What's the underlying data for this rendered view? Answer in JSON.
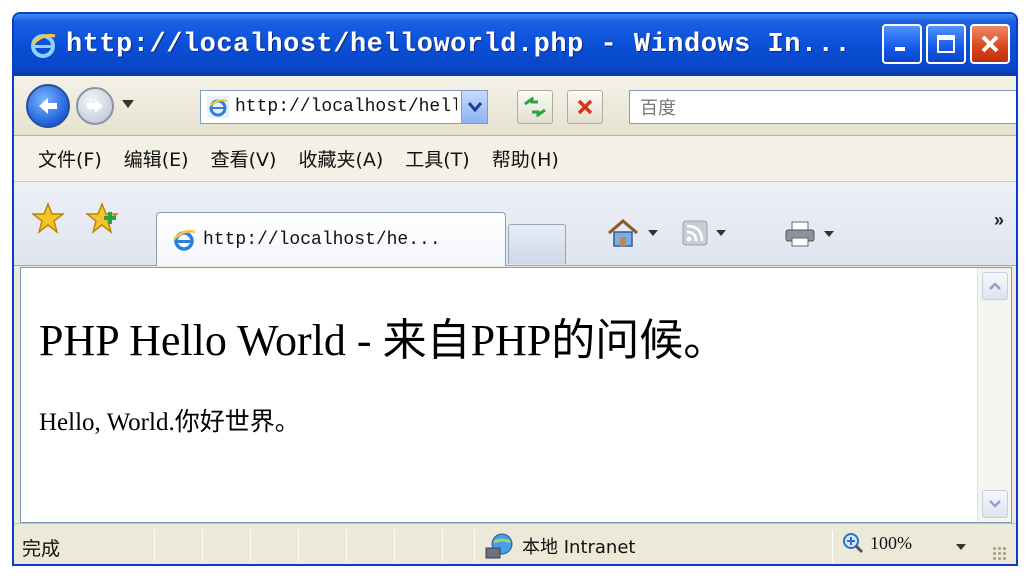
{
  "window": {
    "title": "http://localhost/helloworld.php - Windows In..."
  },
  "address_bar": {
    "url": "http://localhost/helloworld.php",
    "search_placeholder": "百度"
  },
  "menu": {
    "items": [
      "文件(F)",
      "编辑(E)",
      "查看(V)",
      "收藏夹(A)",
      "工具(T)",
      "帮助(H)"
    ]
  },
  "tabs": {
    "active_label": "http://localhost/he...",
    "overflow": "»"
  },
  "page": {
    "heading": "PHP Hello World - 来自PHP的问候。",
    "body": "Hello, World.你好世界。"
  },
  "status": {
    "text": "完成",
    "zone": "本地 Intranet",
    "zoom": "100%"
  },
  "colors": {
    "titlebar": "#0a4fd8",
    "close_button": "#d9431b",
    "chrome": "#ece9d8"
  },
  "icons": [
    "ie-icon",
    "minimize-icon",
    "maximize-icon",
    "close-icon",
    "back-icon",
    "forward-icon",
    "refresh-icon",
    "stop-icon",
    "favorites-star-icon",
    "add-favorites-icon",
    "home-icon",
    "feeds-icon",
    "print-icon",
    "intranet-icon",
    "zoom-icon"
  ]
}
